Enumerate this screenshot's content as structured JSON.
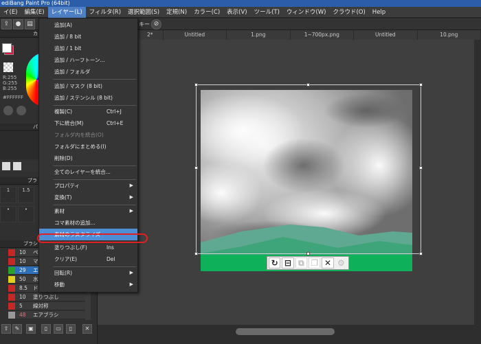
{
  "window": {
    "title": "ediBang Paint Pro (64bit)"
  },
  "menubar": [
    {
      "label": "イ(E)"
    },
    {
      "label": "編集(E)"
    },
    {
      "label": "レイヤー(L)"
    },
    {
      "label": "フィルタ(R)"
    },
    {
      "label": "選択範囲(S)"
    },
    {
      "label": "定規(N)"
    },
    {
      "label": "カラー(C)"
    },
    {
      "label": "表示(V)"
    },
    {
      "label": "ツール(T)"
    },
    {
      "label": "ウィンドウ(W)"
    },
    {
      "label": "クラウド(O)"
    },
    {
      "label": "Help"
    }
  ],
  "toolbar": {
    "key_label": "キー"
  },
  "tabs": [
    {
      "label": "2*"
    },
    {
      "label": "Untitled"
    },
    {
      "label": "1.png"
    },
    {
      "label": "1~700px.png"
    },
    {
      "label": "Untitled"
    },
    {
      "label": "10.png"
    }
  ],
  "color_panel": {
    "r": "R:255",
    "g": "G:255",
    "b": "B:255",
    "hex": "#FFFFFF",
    "header_a": "カ",
    "header_b": "パ"
  },
  "brush_panel": {
    "header_a": "ブラ",
    "header_b": "ブラシ",
    "sizes": [
      "1",
      "1.5",
      "•",
      "•"
    ],
    "rows": [
      {
        "num": "10",
        "name": "ペ",
        "color": "#c62828"
      },
      {
        "num": "10",
        "name": "マ",
        "color": "#c62828"
      },
      {
        "num": "29",
        "name": "エ",
        "color": "#2aa12a",
        "selected": true
      },
      {
        "num": "50",
        "name": "水",
        "color": "#e0d020"
      },
      {
        "num": "8.5",
        "name": "ド",
        "color": "#c62828"
      },
      {
        "num": "10",
        "name": "塗りつぶし",
        "color": "#c62828"
      },
      {
        "num": "5",
        "name": "線対称",
        "color": "#c62828"
      },
      {
        "num": "48",
        "name": "エアブラシ",
        "color": "#999999"
      }
    ]
  },
  "layer_menu": {
    "items": [
      {
        "label": "追加(A)"
      },
      {
        "label": "追加 / 8 bit"
      },
      {
        "label": "追加 / 1 bit"
      },
      {
        "label": "追加 / ハーフトーン..."
      },
      {
        "label": "追加 / フォルダ"
      },
      {
        "label": "追加 / マスク (8 bit)"
      },
      {
        "label": "追加 / ステンシル (8 bit)"
      },
      {
        "label": "複製(C)",
        "shortcut": "Ctrl+J"
      },
      {
        "label": "下に統合(M)",
        "shortcut": "Ctrl+E"
      },
      {
        "label": "フォルダ内を統合(O)",
        "disabled": true
      },
      {
        "label": "フォルダにまとめる(I)"
      },
      {
        "label": "削除(D)"
      },
      {
        "label": "全てのレイヤーを統合..."
      },
      {
        "label": "プロパティ",
        "arrow": "▶"
      },
      {
        "label": "変換(T)",
        "arrow": "▶"
      },
      {
        "label": "素材",
        "arrow": "▶"
      },
      {
        "label": "コマ素材の追加..."
      },
      {
        "label": "素材のラスタライズ",
        "highlighted": true
      },
      {
        "label": "塗りつぶし(F)",
        "shortcut": "Ins"
      },
      {
        "label": "クリア(E)",
        "shortcut": "Del"
      },
      {
        "label": "回転(R)",
        "arrow": "▶"
      },
      {
        "label": "移動",
        "arrow": "▶"
      }
    ]
  },
  "colors": {
    "accent": "#4d8ed6",
    "callout": "#e02020",
    "grass_front": "#0fb05a",
    "grass_back": "#5fa891"
  },
  "icons": [
    "rotate-icon",
    "lock-icon",
    "duplicate-icon",
    "copy-icon",
    "close-icon",
    "gear-icon",
    "clear-icon"
  ]
}
